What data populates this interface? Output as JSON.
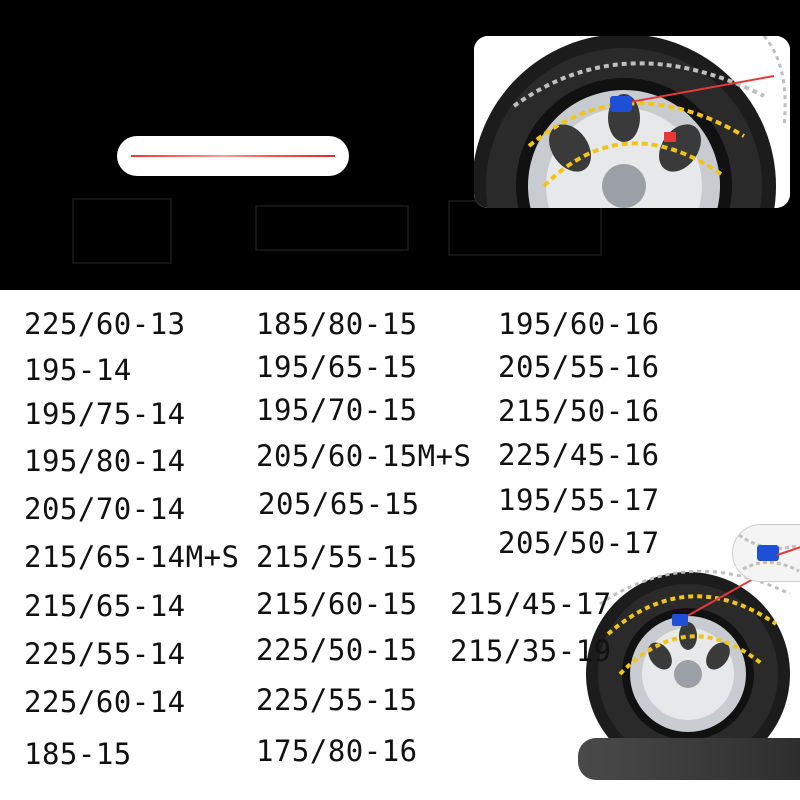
{
  "sizes": {
    "column_1": [
      "225/60-13",
      "195-14",
      "195/75-14",
      "195/80-14",
      "205/70-14",
      "215/65-14M+S",
      "215/65-14",
      "225/55-14",
      "225/60-14",
      "185-15"
    ],
    "column_2": [
      "185/80-15",
      "195/65-15",
      "195/70-15",
      "205/60-15M+S",
      "205/65-15",
      "215/55-15",
      "215/60-15",
      "225/50-15",
      "225/55-15",
      "175/80-16"
    ],
    "column_3": [
      "195/60-16",
      "205/55-16",
      "215/50-16",
      "225/45-16",
      "195/55-17",
      "205/50-17",
      "215/45-17",
      "215/35-19"
    ]
  },
  "colors": {
    "background_top": "#000000",
    "background_bottom": "#ffffff",
    "text": "#111111",
    "chain_link": "#f0c419",
    "tensioner": "#1f4fd6",
    "cable": "#e63a3a",
    "tire": "#1c1c1c",
    "rim": "#c8ccd0"
  },
  "images": {
    "cable": "red-tension-cable-image",
    "wheel_large": "wheel-with-snow-chain-photo",
    "wheel_small": "wheel-with-snow-chain-photo",
    "detail": "chain-tensioner-closeup"
  }
}
